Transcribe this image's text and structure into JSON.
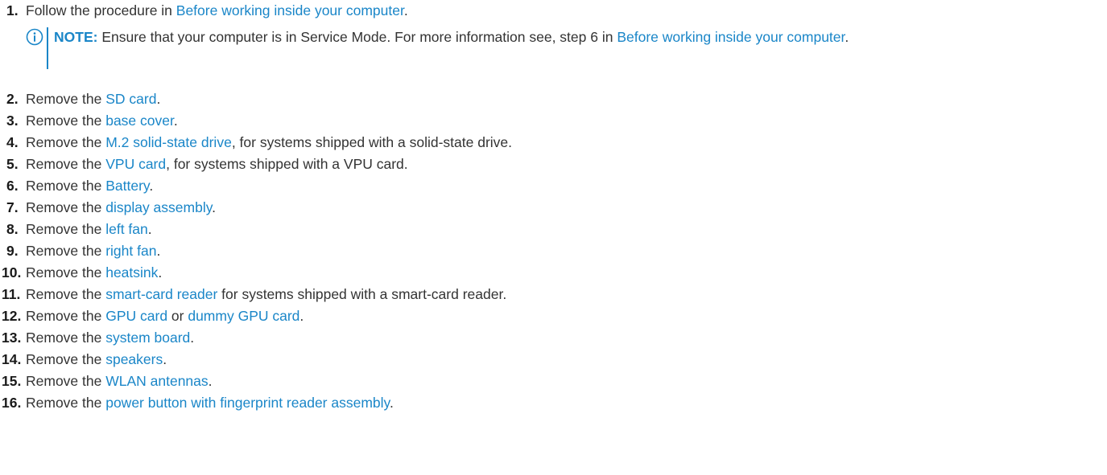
{
  "step1": {
    "number": "1.",
    "text_before": "Follow the procedure in ",
    "link": "Before working inside your computer",
    "text_after": "."
  },
  "note": {
    "icon": "info-circle-icon",
    "label": "NOTE:",
    "text": " Ensure that your computer is in Service Mode. For more information see, step 6 in ",
    "link": "Before working inside your computer",
    "text_after": "."
  },
  "steps": [
    {
      "number": "2.",
      "before": "Remove the ",
      "link": "SD card",
      "after": "."
    },
    {
      "number": "3.",
      "before": "Remove the ",
      "link": "base cover",
      "after": "."
    },
    {
      "number": "4.",
      "before": "Remove the ",
      "link": "M.2 solid-state drive",
      "after": ", for systems shipped with a solid-state drive."
    },
    {
      "number": "5.",
      "before": "Remove the ",
      "link": "VPU card",
      "after": ", for systems shipped with a VPU card."
    },
    {
      "number": "6.",
      "before": "Remove the ",
      "link": "Battery",
      "after": "."
    },
    {
      "number": "7.",
      "before": "Remove the ",
      "link": "display assembly",
      "after": "."
    },
    {
      "number": "8.",
      "before": "Remove the ",
      "link": "left fan",
      "after": "."
    },
    {
      "number": "9.",
      "before": "Remove the ",
      "link": "right fan",
      "after": "."
    },
    {
      "number": "10.",
      "before": "Remove the ",
      "link": "heatsink",
      "after": "."
    },
    {
      "number": "11.",
      "before": "Remove the ",
      "link": "smart-card reader",
      "after": " for systems shipped with a smart-card reader."
    },
    {
      "number": "12.",
      "before": "Remove the ",
      "link": "GPU card",
      "middle": " or ",
      "link2": "dummy GPU card",
      "after": "."
    },
    {
      "number": "13.",
      "before": "Remove the ",
      "link": "system board",
      "after": "."
    },
    {
      "number": "14.",
      "before": "Remove the ",
      "link": "speakers",
      "after": "."
    },
    {
      "number": "15.",
      "before": "Remove the ",
      "link": "WLAN antennas",
      "after": "."
    },
    {
      "number": "16.",
      "before": "Remove the ",
      "link": "power button with fingerprint reader assembly",
      "after": "."
    }
  ],
  "colors": {
    "link": "#1a86c8",
    "text": "#333333"
  }
}
